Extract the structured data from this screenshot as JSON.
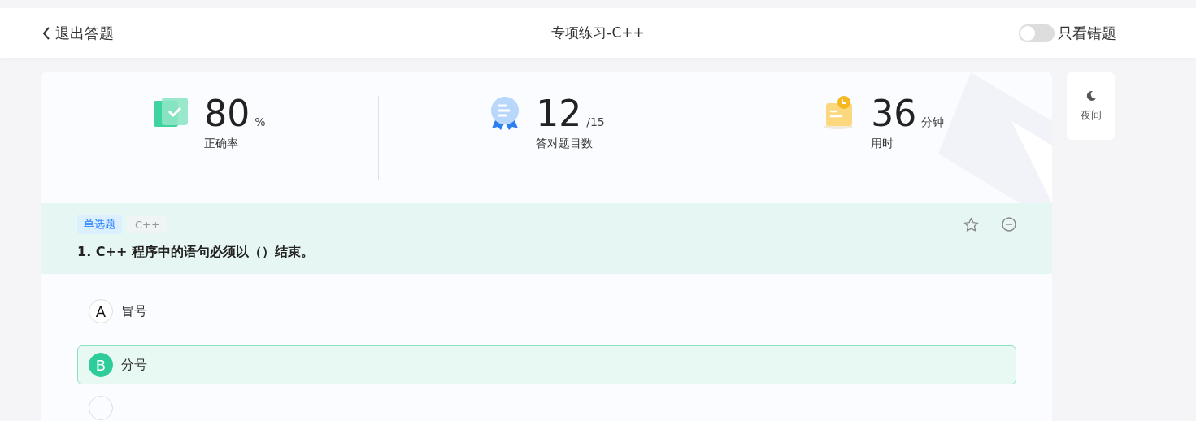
{
  "header": {
    "back_label": "退出答题",
    "title": "专项练习-C++",
    "toggle": {
      "label": "只看错题",
      "on": false
    }
  },
  "stats": [
    {
      "kind": "accuracy",
      "value": "80",
      "unit": "%",
      "label": "正确率"
    },
    {
      "kind": "correct",
      "value": "12",
      "unit": "/15",
      "label": "答对题目数"
    },
    {
      "kind": "time",
      "value": "36",
      "unit": "分钟",
      "label": "用时"
    }
  ],
  "night_button": {
    "label": "夜间"
  },
  "question": {
    "type_tag": "单选题",
    "subject_tag": "C++",
    "text": "1. C++ 程序中的语句必须以（）结束。",
    "starred": false,
    "options": [
      {
        "letter": "A",
        "text": "冒号",
        "selected": false
      },
      {
        "letter": "B",
        "text": "分号",
        "selected": true
      }
    ]
  }
}
